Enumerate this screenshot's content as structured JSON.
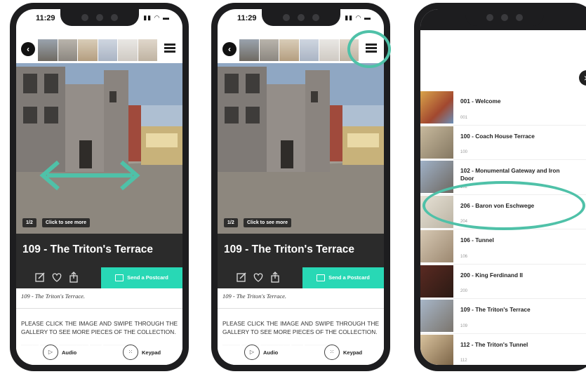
{
  "status": {
    "time": "11:29"
  },
  "stop": {
    "title": "109 - The Triton's Terrace",
    "subtitle": "109 - The Triton's Terrace.",
    "pager": "1/2",
    "see_more": "Click to see more",
    "postcard_label": "Send a Postcard",
    "body": "PLEASE CLICK THE IMAGE AND SWIPE THROUGH THE GALLERY TO SEE MORE PIECES OF THE COLLECTION.",
    "audio_label": "Audio",
    "keypad_label": "Keypad"
  },
  "icons": [
    "back-icon",
    "menu-icon",
    "edit-icon",
    "heart-icon",
    "share-icon",
    "postcard-icon",
    "play-icon",
    "keypad-icon",
    "close-icon",
    "swipe-arrow-icon"
  ],
  "colors": {
    "accent": "#28d8b5",
    "highlight": "#4fc1a8",
    "dark_bar": "#2b2b2b"
  },
  "stop_list": [
    {
      "title": "001 - Welcome",
      "number": "001"
    },
    {
      "title": "100 - Coach House Terrace",
      "number": "100"
    },
    {
      "title": "102 - Monumental Gateway and Iron Door",
      "number": "102"
    },
    {
      "title": "206 - Baron von Eschwege",
      "number": "204"
    },
    {
      "title": "106 - Tunnel",
      "number": "106"
    },
    {
      "title": "200 - King Ferdinand II",
      "number": "200"
    },
    {
      "title": "109 - The Triton's Terrace",
      "number": "109"
    },
    {
      "title": "112 - The Triton's Tunnel",
      "number": "112"
    }
  ]
}
